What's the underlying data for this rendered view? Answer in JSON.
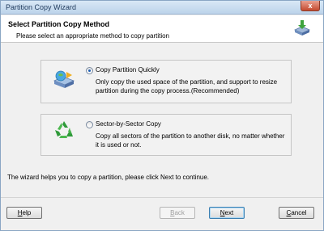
{
  "window": {
    "title": "Partition Copy Wizard",
    "close_label": "x"
  },
  "header": {
    "title": "Select Partition Copy Method",
    "subtitle": "Please select an appropriate method to copy partition"
  },
  "options": [
    {
      "label": "Copy Partition Quickly",
      "description": "Only copy the used space of the partition, and support to resize partition during the copy process.(Recommended)",
      "selected": true,
      "icon": "disk-copy-icon"
    },
    {
      "label": "Sector-by-Sector Copy",
      "description": "Copy all sectors of the partition to another disk, no matter whether it is used or not.",
      "selected": false,
      "icon": "recycle-icon"
    }
  ],
  "hint": "The wizard helps you to copy a partition, please click Next to continue.",
  "buttons": {
    "help": {
      "first": "H",
      "rest": "elp"
    },
    "back": {
      "first": "B",
      "rest": "ack",
      "disabled": true
    },
    "next": {
      "first": "N",
      "rest": "ext"
    },
    "cancel": {
      "first": "C",
      "rest": "ancel"
    }
  }
}
